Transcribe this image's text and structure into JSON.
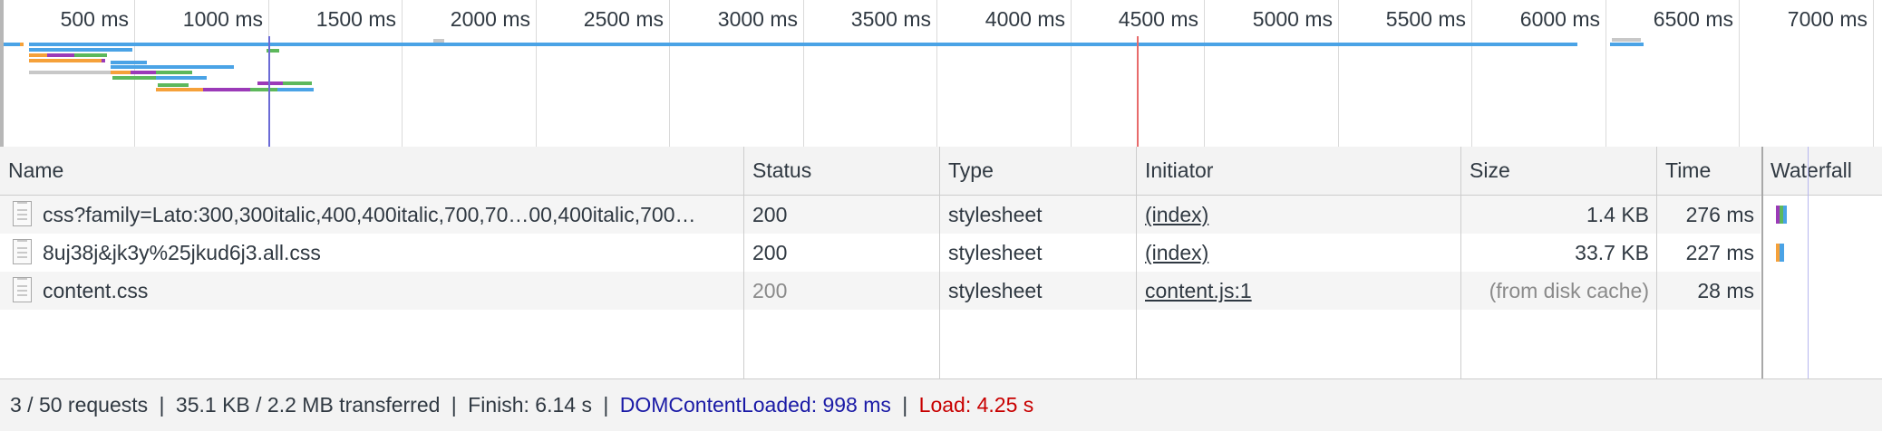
{
  "overview": {
    "ticks": [
      "500 ms",
      "1000 ms",
      "1500 ms",
      "2000 ms",
      "2500 ms",
      "3000 ms",
      "3500 ms",
      "4000 ms",
      "4500 ms",
      "5000 ms",
      "5500 ms",
      "6000 ms",
      "6500 ms",
      "7000 ms"
    ]
  },
  "colors": {
    "blue": "#4aa3e6",
    "green": "#5db85c",
    "orange": "#f5a13a",
    "purple": "#9b3ab8",
    "gray": "#c8c8c8",
    "dcl_marker": "#6b6bd6",
    "load_marker": "#e86b6b"
  },
  "table": {
    "columns": [
      "Name",
      "Status",
      "Type",
      "Initiator",
      "Size",
      "Time",
      "Waterfall"
    ],
    "rows": [
      {
        "name": "css?family=Lato:300,300italic,400,400italic,700,70…00,400italic,700…",
        "status": "200",
        "type": "stylesheet",
        "initiator": "(index)",
        "size": "1.4 KB",
        "time": "276 ms"
      },
      {
        "name": "8uj38j&jk3y%25jkud6j3.all.css",
        "status": "200",
        "type": "stylesheet",
        "initiator": "(index)",
        "size": "33.7 KB",
        "time": "227 ms"
      },
      {
        "name": "content.css",
        "status": "200",
        "type": "stylesheet",
        "initiator": "content.js:1",
        "size": "(from disk cache)",
        "time": "28 ms"
      }
    ]
  },
  "status_bar": {
    "requests": "3 / 50 requests",
    "transferred": "35.1 KB / 2.2 MB transferred",
    "finish": "Finish: 6.14 s",
    "dcl": "DOMContentLoaded: 998 ms",
    "load": "Load: 4.25 s",
    "separator": "|"
  }
}
